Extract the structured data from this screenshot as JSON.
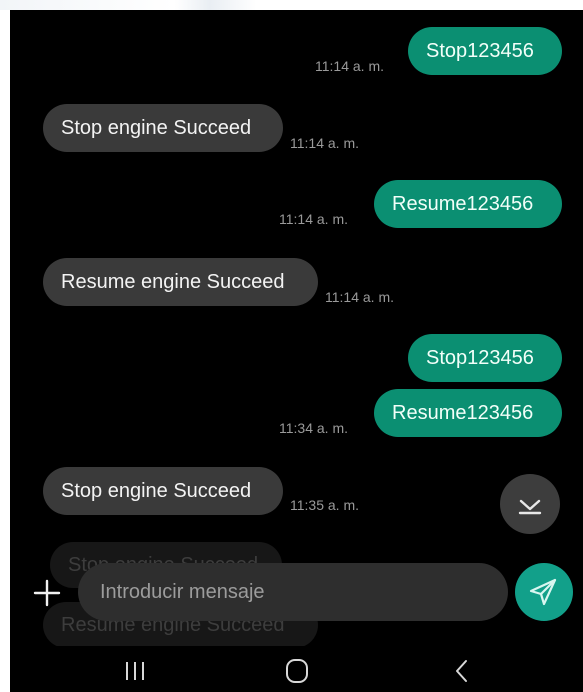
{
  "messages": [
    {
      "text": "Stop123456",
      "time": "11:14 a. m."
    },
    {
      "text": "Stop engine Succeed",
      "time": "11:14 a. m."
    },
    {
      "text": "Resume123456",
      "time": "11:14 a. m."
    },
    {
      "text": "Resume engine Succeed",
      "time": "11:14 a. m."
    },
    {
      "text": "Stop123456",
      "time": ""
    },
    {
      "text": "Resume123456",
      "time": "11:34 a. m."
    },
    {
      "text": "Stop engine Succeed",
      "time": "11:35 a. m."
    }
  ],
  "faded_messages": [
    "Stop engine Succeed",
    "Resume engine Succeed"
  ],
  "composer": {
    "placeholder": "Introducir mensaje"
  },
  "icons": {
    "add": "plus-icon",
    "send": "send-icon",
    "scroll": "chevron-down-icon",
    "recents": "recents-icon",
    "home": "home-icon",
    "back": "back-icon"
  },
  "colors": {
    "outgoing": "#0b8f72",
    "incoming": "#3a3a3a",
    "send": "#12a08a",
    "background": "#000000"
  }
}
